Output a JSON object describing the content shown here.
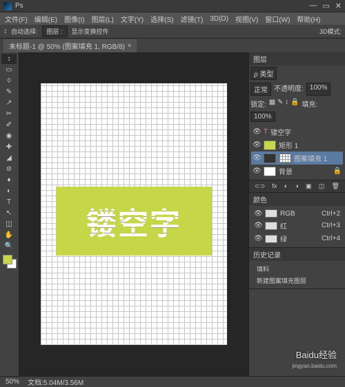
{
  "title": "Ps",
  "menu": [
    "文件(F)",
    "编辑(E)",
    "图像(I)",
    "图层(L)",
    "文字(Y)",
    "选择(S)",
    "滤镜(T)",
    "3D(D)",
    "视图(V)",
    "窗口(W)",
    "帮助(H)"
  ],
  "optbar": {
    "autoselect": "自动选择:",
    "mode": "图层 :",
    "showtransform": "显示变换控件",
    "extra": "3D模式:"
  },
  "tab": {
    "name": "未标题-1 @ 50% (图案填充 1, RGB/8)",
    "close": "×"
  },
  "tools": [
    "↕",
    "▭",
    "◊",
    "✎",
    "↗",
    "✂",
    "✐",
    "◉",
    "✚",
    "◢",
    "⊘",
    "♦",
    "◐",
    "T",
    "↖",
    "◫",
    "✋",
    "🔍"
  ],
  "canvas_text": "镂空字",
  "panels": {
    "layers": {
      "title": "图层",
      "kind": "ρ 类型",
      "opacity_lbl": "不透明度:",
      "opacity": "100%",
      "blend": "正常",
      "lock_lbl": "锁定:",
      "fill_lbl": "填充:",
      "fill": "100%",
      "items": [
        {
          "type": "text",
          "name": "镂空字",
          "vis": "👁"
        },
        {
          "type": "shape",
          "name": "矩形 1",
          "vis": "👁"
        },
        {
          "type": "fill",
          "name": "图案填充 1",
          "vis": "👁",
          "selected": true
        },
        {
          "type": "bg",
          "name": "背景",
          "vis": "👁",
          "locked": "🔒"
        }
      ]
    },
    "channels": {
      "title": "颜色",
      "items": [
        {
          "name": "RGB",
          "key": "Ctrl+2"
        },
        {
          "name": "红",
          "key": "Ctrl+3"
        },
        {
          "name": "绿",
          "key": "Ctrl+4"
        }
      ]
    },
    "history": {
      "title": "历史记录",
      "items": [
        "填料",
        "新建图案填充图层"
      ]
    }
  },
  "status": {
    "zoom": "50%",
    "doc": "文档:5.04M/3.56M"
  },
  "watermark": "Baidu经验",
  "watermark2": "jingyan.baidu.com"
}
